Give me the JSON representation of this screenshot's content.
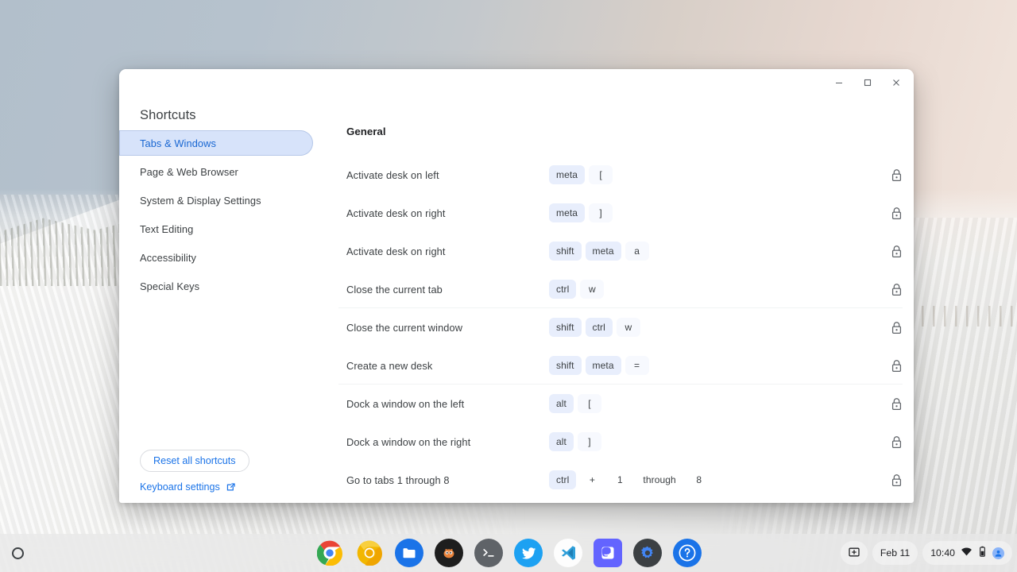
{
  "window": {
    "title": "Shortcuts",
    "controls": [
      {
        "name": "minimize",
        "glyph": "minimize-icon"
      },
      {
        "name": "maximize",
        "glyph": "maximize-icon"
      },
      {
        "name": "close",
        "glyph": "close-icon"
      }
    ]
  },
  "sidebar": {
    "items": [
      {
        "label": "Tabs & Windows",
        "selected": true
      },
      {
        "label": "Page & Web Browser",
        "selected": false
      },
      {
        "label": "System & Display Settings",
        "selected": false
      },
      {
        "label": "Text Editing",
        "selected": false
      },
      {
        "label": "Accessibility",
        "selected": false
      },
      {
        "label": "Special Keys",
        "selected": false
      }
    ],
    "reset_button": "Reset all shortcuts",
    "keyboard_settings_link": "Keyboard settings"
  },
  "content": {
    "group_title": "General",
    "rows": [
      {
        "label": "Activate desk on left",
        "keys": [
          {
            "text": "meta",
            "style": "mod"
          },
          {
            "text": "[",
            "style": "plain"
          }
        ],
        "lock": "lock-icon",
        "divider": false
      },
      {
        "label": "Activate desk on right",
        "keys": [
          {
            "text": "meta",
            "style": "mod"
          },
          {
            "text": "]",
            "style": "plain"
          }
        ],
        "lock": "lock-icon",
        "divider": false
      },
      {
        "label": "Activate desk on right",
        "keys": [
          {
            "text": "shift",
            "style": "mod"
          },
          {
            "text": "meta",
            "style": "mod"
          },
          {
            "text": "a",
            "style": "plain"
          }
        ],
        "lock": "lock-icon",
        "divider": false
      },
      {
        "label": "Close the current tab",
        "keys": [
          {
            "text": "ctrl",
            "style": "mod"
          },
          {
            "text": "w",
            "style": "plain"
          }
        ],
        "lock": "lock-icon",
        "divider": true
      },
      {
        "label": "Close the current window",
        "keys": [
          {
            "text": "shift",
            "style": "mod"
          },
          {
            "text": "ctrl",
            "style": "mod"
          },
          {
            "text": "w",
            "style": "plain"
          }
        ],
        "lock": "lock-icon",
        "divider": false
      },
      {
        "label": "Create a new desk",
        "keys": [
          {
            "text": "shift",
            "style": "mod"
          },
          {
            "text": "meta",
            "style": "mod"
          },
          {
            "text": "=",
            "style": "plain"
          }
        ],
        "lock": "lock-icon",
        "divider": true
      },
      {
        "label": "Dock a window on the left",
        "keys": [
          {
            "text": "alt",
            "style": "mod"
          },
          {
            "text": "[",
            "style": "plain"
          }
        ],
        "lock": "lock-icon",
        "divider": false
      },
      {
        "label": "Dock a window on the right",
        "keys": [
          {
            "text": "alt",
            "style": "mod"
          },
          {
            "text": "]",
            "style": "plain"
          }
        ],
        "lock": "lock-icon",
        "divider": false
      },
      {
        "label": "Go to tabs 1 through 8",
        "keys": [
          {
            "text": "ctrl",
            "style": "mod"
          },
          {
            "text": "+",
            "style": "bare"
          },
          {
            "text": "1",
            "style": "bare"
          },
          {
            "text": "through",
            "style": "bare"
          },
          {
            "text": "8",
            "style": "bare"
          }
        ],
        "lock": "lock-icon",
        "divider": false
      }
    ]
  },
  "shelf": {
    "launcher": "launcher-icon",
    "apps": [
      {
        "name": "chrome",
        "label": "Chrome",
        "running": true
      },
      {
        "name": "chrome-canary",
        "label": "Chrome Canary",
        "running": false
      },
      {
        "name": "files",
        "label": "Files",
        "running": false
      },
      {
        "name": "dark-app",
        "label": "App",
        "running": false
      },
      {
        "name": "terminal",
        "label": "Terminal",
        "running": false
      },
      {
        "name": "twitter",
        "label": "Twitter",
        "running": false
      },
      {
        "name": "vscode",
        "label": "Visual Studio Code",
        "running": false
      },
      {
        "name": "mastodon",
        "label": "Mastodon",
        "running": true
      },
      {
        "name": "settings",
        "label": "Settings",
        "running": true
      },
      {
        "name": "help",
        "label": "Help",
        "running": true
      }
    ],
    "status": {
      "capture_icon": "screen-capture-icon",
      "date": "Feb 11",
      "time": "10:40",
      "wifi_icon": "wifi-icon",
      "battery_icon": "battery-icon",
      "avatar": "user-avatar"
    }
  },
  "colors": {
    "accent": "#1a73e8",
    "selected_bg": "#d7e3fa",
    "modifier_chip": "#e8eefc",
    "plain_chip": "#f7f9fe"
  }
}
